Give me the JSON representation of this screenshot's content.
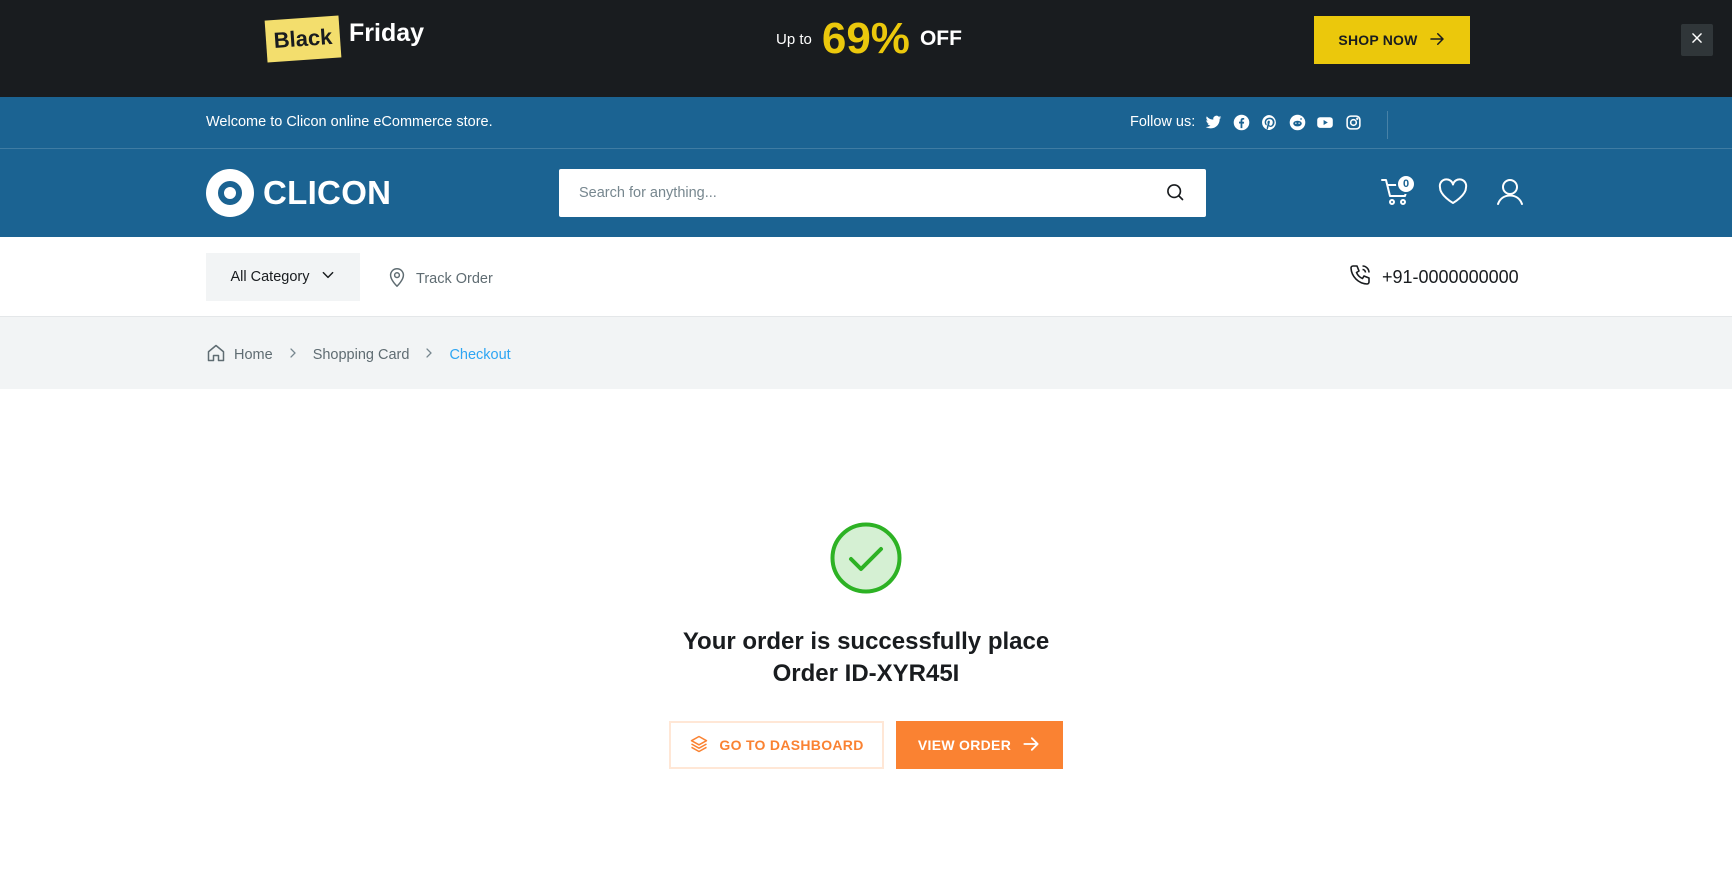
{
  "promo": {
    "tag": "Black",
    "title": "Friday",
    "upto": "Up to",
    "percent": "69%",
    "off": "OFF",
    "cta": "SHOP NOW"
  },
  "topbar": {
    "welcome": "Welcome to Clicon online eCommerce store.",
    "follow": "Follow us:",
    "socials": [
      "twitter-icon",
      "facebook-icon",
      "pinterest-icon",
      "reddit-icon",
      "youtube-icon",
      "instagram-icon"
    ]
  },
  "header": {
    "logo": "CLICON",
    "search_placeholder": "Search for anything...",
    "cart_count": "0"
  },
  "nav": {
    "all_category": "All Category",
    "track_order": "Track Order",
    "phone": "+91-0000000000"
  },
  "breadcrumb": {
    "home": "Home",
    "cart": "Shopping Card",
    "current": "Checkout"
  },
  "success": {
    "line1": "Your order is successfully place",
    "line2": "Order ID-XYR45I",
    "dashboard_btn": "GO TO DASHBOARD",
    "view_btn": "VIEW ORDER"
  },
  "colors": {
    "promo_bg": "#191C1F",
    "brand_blue": "#1B6392",
    "accent_yellow": "#EBC80C",
    "accent_orange": "#FA8232",
    "success_green": "#2DB224",
    "link_blue": "#2DA5F3"
  }
}
